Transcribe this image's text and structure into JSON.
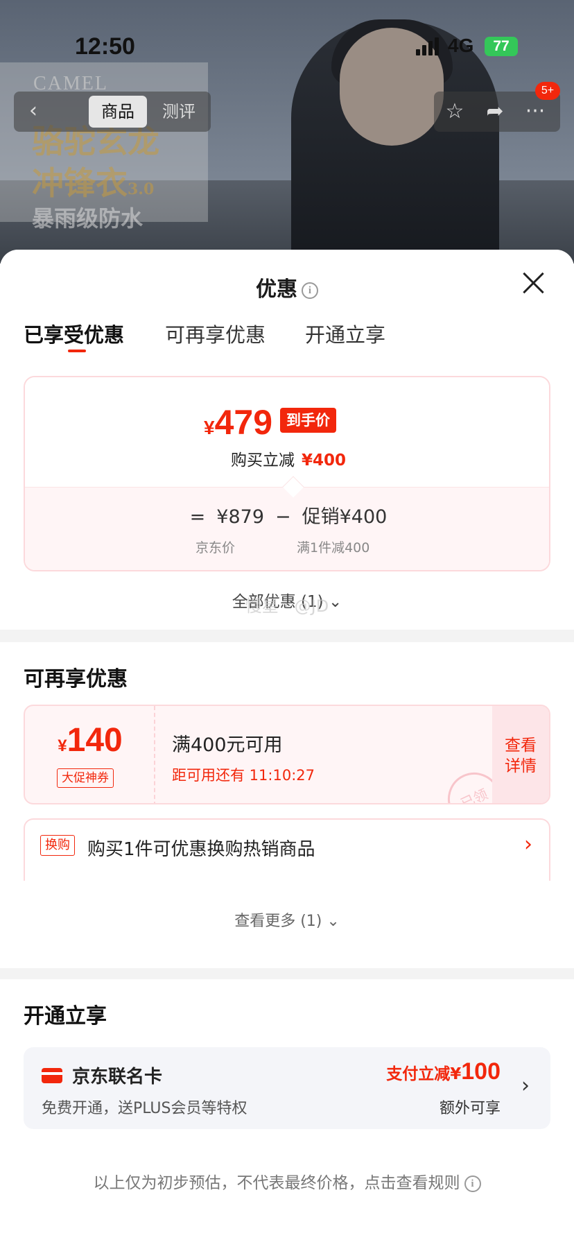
{
  "status_bar": {
    "time": "12:50",
    "network": "4G",
    "battery": "77"
  },
  "hero": {
    "brand": "CAMEL",
    "headline1": "骆驼玄龙",
    "headline2": "冲锋衣",
    "headline2_suffix": "3.0",
    "headline3": "暴雨级防水"
  },
  "nav": {
    "back_icon": "‹",
    "tabs": [
      "商品",
      "测评"
    ],
    "badge": "5+"
  },
  "sheet": {
    "title": "优惠",
    "tabs": [
      "已享受优惠",
      "可再享优惠",
      "开通立享"
    ],
    "price_card": {
      "currency": "¥",
      "final_price": "479",
      "final_tag": "到手价",
      "instant_label": "购买立减",
      "instant_amount": "¥400",
      "equals": "=",
      "jd_price": "¥879",
      "minus": "−",
      "promo": "促销¥400",
      "jd_price_label": "京东价",
      "promo_label": "满1件减400"
    },
    "all_offers": "全部优惠 (1) ⌄",
    "watermark": "慢星 · @JD"
  },
  "more_offers": {
    "title": "可再享优惠",
    "coupon": {
      "currency": "¥",
      "amount": "140",
      "tag": "大促神券",
      "condition": "满400元可用",
      "timer": "距可用还有 11:10:27",
      "cta": [
        "查看",
        "详情"
      ],
      "stamp": "已领"
    },
    "swap": {
      "tag": "换购",
      "text": "购买1件可优惠换购热销商品",
      "arrow": "›"
    },
    "see_more": "查看更多 (1) ⌄"
  },
  "open_now": {
    "title": "开通立享",
    "card": {
      "name": "京东联名卡",
      "desc": "免费开通，送PLUS会员等特权",
      "save_label": "支付立减¥",
      "save_amount": "100",
      "extra": "额外可享",
      "arrow": "›"
    }
  },
  "disclaimer": "以上仅为初步预估，不代表最终价格，点击查看规则",
  "colors": {
    "accent": "#f2270c",
    "pink_border": "#fcd9dc",
    "pink_bg": "#fff5f6"
  }
}
